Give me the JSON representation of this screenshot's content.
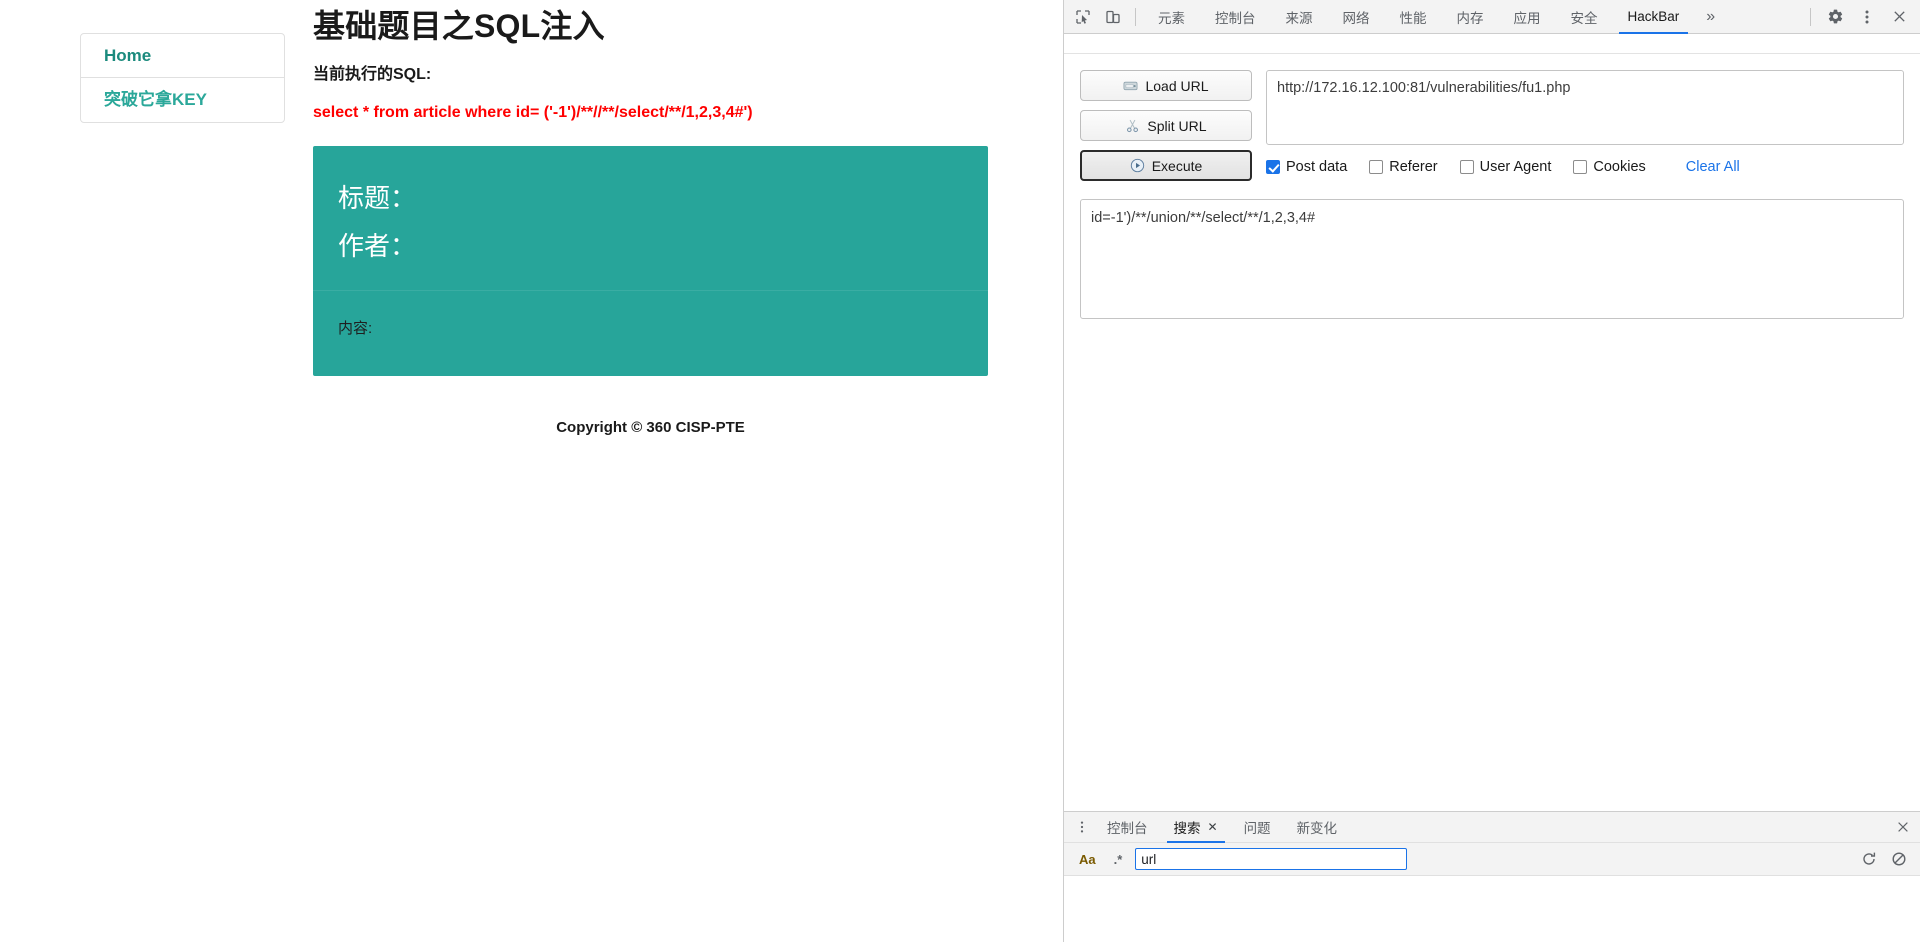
{
  "page": {
    "sidebar": {
      "items": [
        {
          "label": "Home",
          "active": true
        },
        {
          "label": "突破它拿KEY",
          "active": false
        }
      ]
    },
    "title": "基础题目之SQL注入",
    "sql_label": "当前执行的SQL:",
    "sql_statement": "select * from article where id= ('-1')/**//**/select/**/1,2,3,4#')",
    "result": {
      "title_field": "标题：",
      "author_field": "作者：",
      "content_field": "内容:"
    },
    "footer": "Copyright © 360 CISP-PTE",
    "colors": {
      "teal": "#27a59a",
      "sql_red": "#ff0000",
      "link_teal": "#2a9d8f"
    }
  },
  "devtools": {
    "toolbar": {
      "inspect_icon": "inspect-cursor-icon",
      "device_icon": "device-toolbar-icon",
      "tabs": [
        {
          "label": "元素",
          "active": false
        },
        {
          "label": "控制台",
          "active": false
        },
        {
          "label": "来源",
          "active": false
        },
        {
          "label": "网络",
          "active": false
        },
        {
          "label": "性能",
          "active": false
        },
        {
          "label": "内存",
          "active": false
        },
        {
          "label": "应用",
          "active": false
        },
        {
          "label": "安全",
          "active": false
        },
        {
          "label": "HackBar",
          "active": true
        }
      ],
      "more_tabs": "»",
      "settings_icon": "gear-icon",
      "menu_icon": "kebab-menu-icon",
      "close_icon": "close-icon",
      "accent": "#1a73e8"
    },
    "hackbar": {
      "load_url_label": "Load URL",
      "split_url_label": "Split URL",
      "execute_label": "Execute",
      "url_value": "http://172.16.12.100:81/vulnerabilities/fu1.php",
      "options": [
        {
          "label": "Post data",
          "checked": true
        },
        {
          "label": "Referer",
          "checked": false
        },
        {
          "label": "User Agent",
          "checked": false
        },
        {
          "label": "Cookies",
          "checked": false
        }
      ],
      "clear_all_label": "Clear All",
      "post_data_value": "id=-1')/**/union/**/select/**/1,2,3,4#"
    },
    "drawer": {
      "tabs": [
        {
          "label": "控制台",
          "active": false,
          "closable": false
        },
        {
          "label": "搜索",
          "active": true,
          "closable": true
        },
        {
          "label": "问题",
          "active": false,
          "closable": false
        },
        {
          "label": "新变化",
          "active": false,
          "closable": false
        }
      ],
      "close_label": "✕",
      "search": {
        "match_case_label": "Aa",
        "regex_label": ".*",
        "value": "url",
        "placeholder": "",
        "refresh_icon": "refresh-icon",
        "clear_icon": "clear-icon"
      }
    }
  }
}
